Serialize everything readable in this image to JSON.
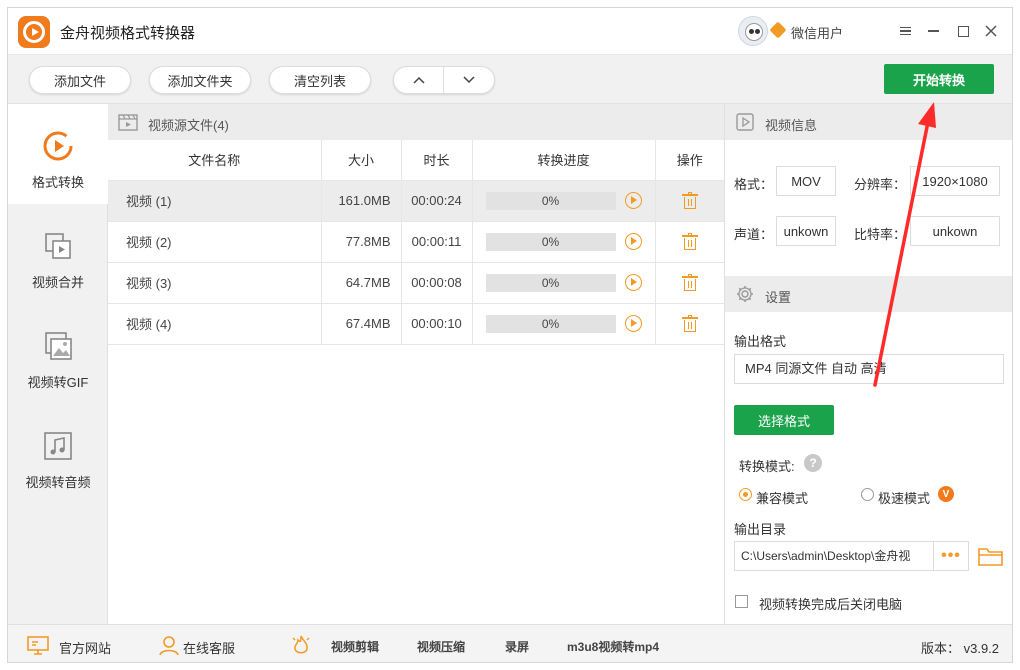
{
  "window": {
    "title": "金舟视频格式转换器",
    "user_name": "微信用户"
  },
  "toolbar": {
    "add_file": "添加文件",
    "add_folder": "添加文件夹",
    "clear_list": "清空列表",
    "move_up_icon": "chevron-up-icon",
    "move_down_icon": "chevron-down-icon",
    "start_convert": "开始转换"
  },
  "sidebar": {
    "items": [
      {
        "label": "格式转换",
        "icon": "convert-icon",
        "active": true
      },
      {
        "label": "视频合并",
        "icon": "merge-icon",
        "active": false
      },
      {
        "label": "视频转GIF",
        "icon": "gif-icon",
        "active": false
      },
      {
        "label": "视频转音频",
        "icon": "audio-icon",
        "active": false
      }
    ]
  },
  "file_list": {
    "title": "视频源文件(4)",
    "columns": [
      "文件名称",
      "大小",
      "时长",
      "转换进度",
      "操作"
    ],
    "rows": [
      {
        "name": "视频 (1)",
        "size": "161.0MB",
        "duration": "00:00:24",
        "progress": "0%",
        "progress_value": 0
      },
      {
        "name": "视频 (2)",
        "size": "77.8MB",
        "duration": "00:00:11",
        "progress": "0%",
        "progress_value": 0
      },
      {
        "name": "视频 (3)",
        "size": "64.7MB",
        "duration": "00:00:08",
        "progress": "0%",
        "progress_value": 0
      },
      {
        "name": "视频 (4)",
        "size": "67.4MB",
        "duration": "00:00:10",
        "progress": "0%",
        "progress_value": 0
      }
    ]
  },
  "video_info": {
    "title": "视频信息",
    "format_label": "格式：",
    "format_value": "MOV",
    "resolution_label": "分辨率：",
    "resolution_value": "1920×1080",
    "channel_label": "声道：",
    "channel_value": "unkown",
    "bitrate_label": "比特率：",
    "bitrate_value": "unkown"
  },
  "settings": {
    "title": "设置",
    "output_format_label": "输出格式",
    "output_format_value": "MP4 同源文件 自动 高清",
    "select_format_button": "选择格式",
    "mode_label": "转换模式:",
    "mode_help": "?",
    "mode_compatible": "兼容模式",
    "mode_fast": "极速模式",
    "vip_badge": "V",
    "output_dir_label": "输出目录",
    "output_dir_value": "C:\\Users\\admin\\Desktop\\金舟视",
    "browse_dots": "•••",
    "shutdown_label": "视频转换完成后关闭电脑",
    "shutdown_checked": false
  },
  "footer": {
    "website": "官方网站",
    "support": "在线客服",
    "video_edit": "视频剪辑",
    "video_compress": "视频压缩",
    "screen_record": "录屏",
    "m3u8": "m3u8视频转mp4",
    "version": "版本： v3.9.2"
  },
  "colors": {
    "accent_green": "#1aa34a",
    "accent_orange": "#f39a25",
    "annotation_red": "#ff2a2a"
  }
}
